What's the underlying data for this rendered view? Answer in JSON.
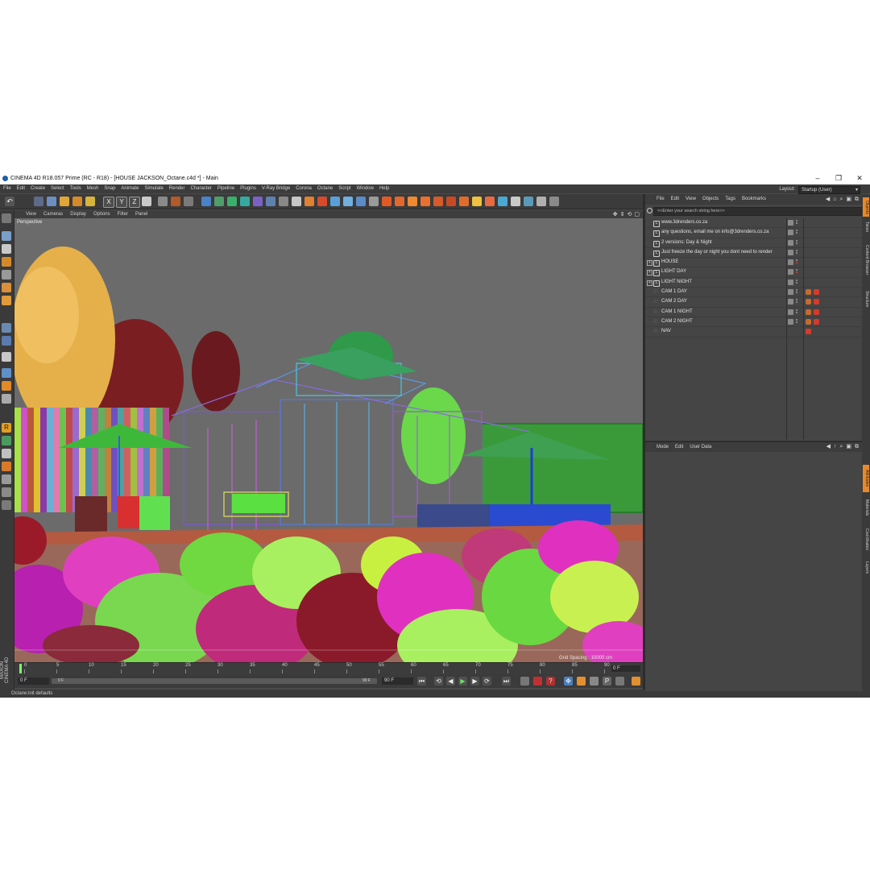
{
  "window": {
    "title": "CINEMA 4D R18.057 Prime (RC - R18) - [HOUSE JACKSON_Octane.c4d *] - Main",
    "controls": [
      "–",
      "❐",
      "✕"
    ]
  },
  "menubar": {
    "items": [
      "File",
      "Edit",
      "Create",
      "Select",
      "Tools",
      "Mesh",
      "Snap",
      "Animate",
      "Simulate",
      "Render",
      "Character",
      "Pipeline",
      "Plugins",
      "V-Ray Bridge",
      "Corona",
      "Octane",
      "Script",
      "Window",
      "Help"
    ],
    "layout_label": "Layout:",
    "layout_value": "Startup (User)"
  },
  "viewport": {
    "menu": [
      "View",
      "Cameras",
      "Display",
      "Options",
      "Filter",
      "Panel"
    ],
    "label": "Perspective",
    "grid_spacing": "Grid Spacing : 10000 cm"
  },
  "timeline": {
    "ticks": [
      "0",
      "5",
      "10",
      "15",
      "20",
      "25",
      "30",
      "35",
      "40",
      "45",
      "50",
      "55",
      "60",
      "65",
      "70",
      "75",
      "80",
      "85",
      "90"
    ],
    "current_frame": "0 F"
  },
  "transport": {
    "start_field": "0 F",
    "slider_start": "0 F",
    "slider_end": "90 F",
    "end_field": "90 F"
  },
  "brand": {
    "maxon": "MAXON CINEMA 4D"
  },
  "status": {
    "text": "Octane:init defaults"
  },
  "object_manager": {
    "menu": [
      "File",
      "Edit",
      "View",
      "Objects",
      "Tags",
      "Bookmarks"
    ],
    "search_placeholder": "<<Enter your search string here>>",
    "objects": [
      {
        "name": "www.3drenders.co.za",
        "icon": "null-icon",
        "expand": false
      },
      {
        "name": "any questions, email me on info@3drenders.co.za",
        "icon": "null-icon",
        "expand": false
      },
      {
        "name": "2 versions: Day & Night",
        "icon": "null-icon",
        "expand": false
      },
      {
        "name": "Just freeze the day or night you dont need to render",
        "icon": "null-icon",
        "expand": false
      },
      {
        "name": "HOUSE",
        "icon": "null-icon",
        "expand": true
      },
      {
        "name": "LIGHT DAY",
        "icon": "null-icon",
        "expand": true
      },
      {
        "name": "LIGHT NIGHT",
        "icon": "null-icon",
        "expand": true
      },
      {
        "name": "CAM 1 DAY",
        "icon": "camera-icon",
        "expand": false
      },
      {
        "name": "CAM 2 DAY",
        "icon": "camera-icon",
        "expand": false
      },
      {
        "name": "CAM 1 NIGHT",
        "icon": "camera-icon",
        "expand": false
      },
      {
        "name": "CAM 2 NIGHT",
        "icon": "camera-icon",
        "expand": false
      },
      {
        "name": "NAV",
        "icon": "camera-icon",
        "expand": false
      }
    ]
  },
  "attribute_manager": {
    "menu": [
      "Mode",
      "Edit",
      "User Data"
    ]
  },
  "right_tabs": [
    "Objects",
    "Takes",
    "Content Browser",
    "Structure",
    "Attributes",
    "Materials",
    "Coordinates",
    "Layers"
  ],
  "colors": {
    "accent": "#e88a2a",
    "panel_bg": "#454545",
    "viewport_bg": "#6b6b6b"
  }
}
